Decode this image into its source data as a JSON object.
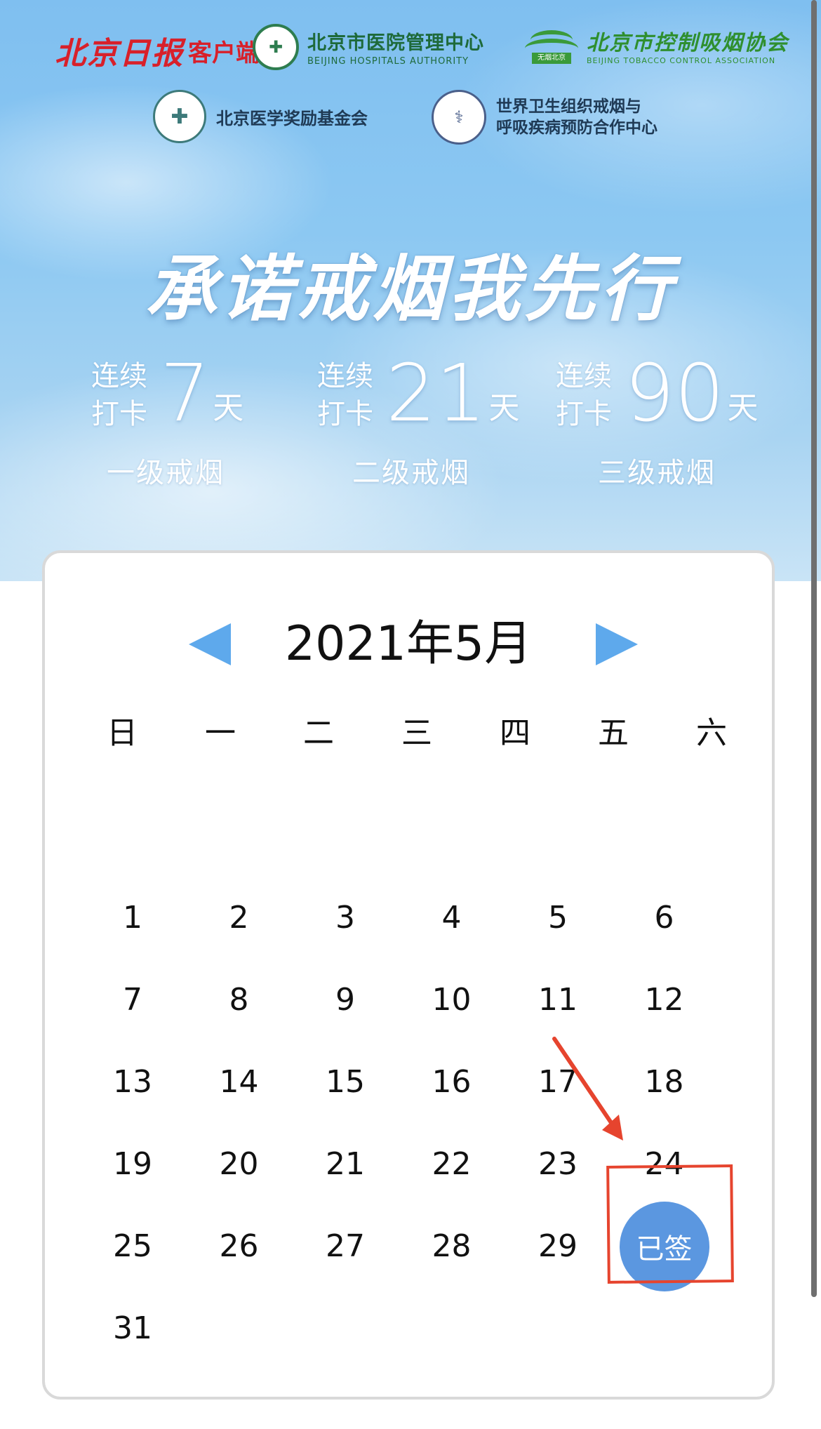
{
  "logos": {
    "rmrb": {
      "name": "北京日报",
      "suffix": "客户端"
    },
    "bha": {
      "cn": "北京市医院管理中心",
      "en": "BEIJING HOSPITALS AUTHORITY"
    },
    "btca": {
      "cn": "北京市控制吸烟协会",
      "en": "BEIJING TOBACCO CONTROL ASSOCIATION",
      "seal": "无烟北京"
    },
    "bmaf": {
      "cn": "北京医学奖励基金会"
    },
    "who": {
      "line1": "世界卫生组织戒烟与",
      "line2": "呼吸疾病预防合作中心"
    }
  },
  "hero": {
    "title": "承诺戒烟我先行",
    "levels": [
      {
        "pre": "连续打卡",
        "num": "7",
        "unit": "天",
        "name": "一级戒烟"
      },
      {
        "pre": "连续打卡",
        "num": "21",
        "unit": "天",
        "name": "二级戒烟"
      },
      {
        "pre": "连续打卡",
        "num": "90",
        "unit": "天",
        "name": "三级戒烟"
      }
    ]
  },
  "calendar": {
    "month_label": "2021年5月",
    "weekdays": [
      "日",
      "一",
      "二",
      "三",
      "四",
      "五",
      "六"
    ],
    "signed_label": "已签",
    "days": [
      [
        "",
        "",
        "",
        "",
        "",
        "",
        ""
      ],
      [
        "1",
        "2",
        "3",
        "4",
        "5",
        "6",
        ""
      ],
      [
        "7",
        "8",
        "9",
        "10",
        "11",
        "12",
        ""
      ],
      [
        "13",
        "14",
        "15",
        "16",
        "17",
        "18",
        ""
      ],
      [
        "19",
        "20",
        "21",
        "22",
        "23",
        "24",
        ""
      ],
      [
        "25",
        "26",
        "27",
        "28",
        "29",
        "SIGNED",
        ""
      ],
      [
        "31",
        "",
        "",
        "",
        "",
        "",
        ""
      ]
    ]
  },
  "colors": {
    "accent": "#5ea9ec",
    "signed": "#5b97e0",
    "annotation": "#e6442e"
  }
}
